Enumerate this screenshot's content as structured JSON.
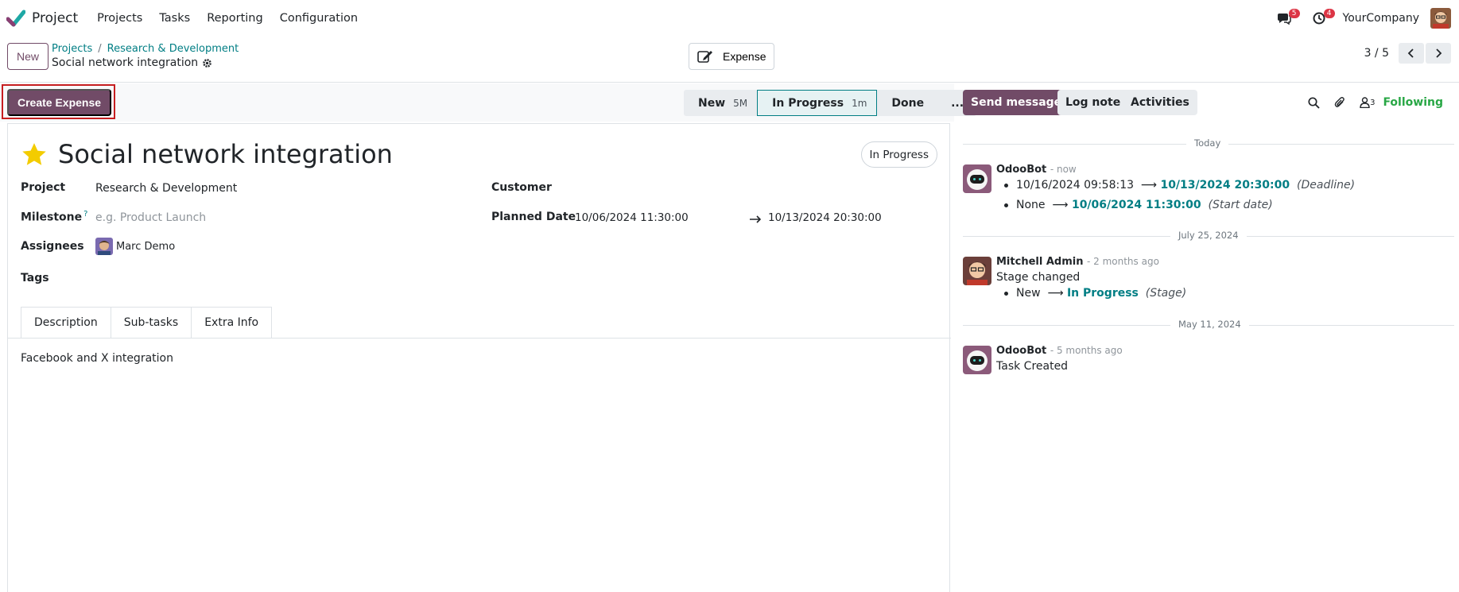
{
  "app": {
    "name": "Project"
  },
  "menu": [
    "Projects",
    "Tasks",
    "Reporting",
    "Configuration"
  ],
  "navbar": {
    "messages_count": "5",
    "activities_count": "4",
    "company": "YourCompany"
  },
  "control": {
    "new_label": "New",
    "breadcrumb": [
      "Projects",
      "Research & Development"
    ],
    "record_title": "Social network integration",
    "expense_label": "Expense",
    "pager": "3 / 5"
  },
  "actions": {
    "create_expense": "Create Expense"
  },
  "stages": [
    {
      "name": "New",
      "count": "5M"
    },
    {
      "name": "In Progress",
      "count": "1m"
    },
    {
      "name": "Done",
      "count": ""
    },
    {
      "name": "...",
      "count": ""
    }
  ],
  "task": {
    "title": "Social network integration",
    "status": "In Progress",
    "project_label": "Project",
    "project_value": "Research & Development",
    "milestone_label": "Milestone",
    "milestone_help": "?",
    "milestone_placeholder": "e.g. Product Launch",
    "assignees_label": "Assignees",
    "assignee": "Marc Demo",
    "tags_label": "Tags",
    "customer_label": "Customer",
    "planned_label": "Planned Date",
    "planned_start": "10/06/2024 11:30:00",
    "planned_end": "10/13/2024 20:30:00",
    "tabs": [
      "Description",
      "Sub-tasks",
      "Extra Info"
    ],
    "description": "Facebook and X integration"
  },
  "chatter": {
    "send_message": "Send message",
    "log_note": "Log note",
    "activities": "Activities",
    "followers_count": "3",
    "following": "Following",
    "dates": [
      "Today",
      "July 25, 2024",
      "May 11, 2024"
    ],
    "messages": [
      {
        "author": "OdooBot",
        "time": "- now",
        "changes": [
          {
            "old": "10/16/2024 09:58:13",
            "new": "10/13/2024 20:30:00",
            "field": "(Deadline)"
          },
          {
            "old": "None",
            "new": "10/06/2024 11:30:00",
            "field": "(Start date)"
          }
        ]
      },
      {
        "author": "Mitchell Admin",
        "time": "- 2 months ago",
        "body": "Stage changed",
        "changes": [
          {
            "old": "New",
            "new": "In Progress",
            "field": "(Stage)"
          }
        ]
      },
      {
        "author": "OdooBot",
        "time": "- 5 months ago",
        "body": "Task Created"
      }
    ]
  }
}
